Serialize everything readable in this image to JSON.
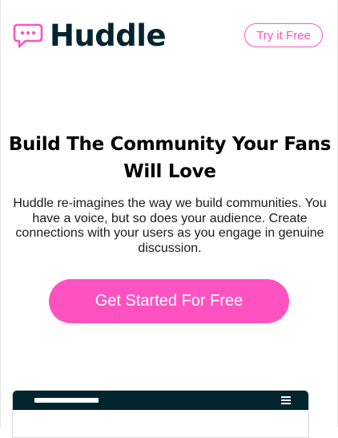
{
  "header": {
    "logo_text": "Huddle",
    "logo_icon": "chat-bubble-icon",
    "try_button_label": "Try it Free"
  },
  "hero": {
    "title_line1": "Build The Community Your Fans",
    "title_line2": "Will Love",
    "description": "Huddle re-imagines the way we build communities. You have a voice, but so does your audience. Create connections with your users as you engage in genuine discussion.",
    "cta_label": "Get Started For Free"
  },
  "mockup": {
    "menu_icon": "hamburger-menu-icon"
  },
  "colors": {
    "accent": "#ff52c1",
    "dark": "#00252e",
    "text": "#000000"
  }
}
